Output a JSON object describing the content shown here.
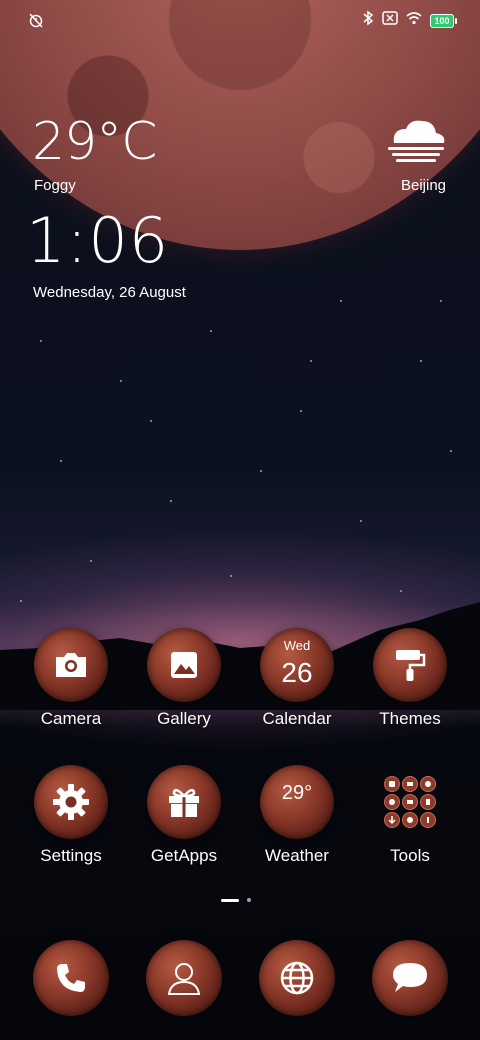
{
  "status": {
    "battery": "100"
  },
  "weather": {
    "temperature": "29°C",
    "condition": "Foggy",
    "city": "Beijing"
  },
  "clock": {
    "time": "1:06",
    "date": "Wednesday, 26 August"
  },
  "apps_row1": [
    {
      "label": "Camera",
      "icon": "camera-icon"
    },
    {
      "label": "Gallery",
      "icon": "image-icon"
    },
    {
      "label": "Calendar",
      "icon": "calendar-icon",
      "day": "Wed",
      "num": "26"
    },
    {
      "label": "Themes",
      "icon": "paint-roller-icon"
    }
  ],
  "apps_row2": [
    {
      "label": "Settings",
      "icon": "gear-icon"
    },
    {
      "label": "GetApps",
      "icon": "gift-icon"
    },
    {
      "label": "Weather",
      "icon": "weather-icon",
      "temp": "29°"
    },
    {
      "label": "Tools",
      "icon": "folder-icon"
    }
  ],
  "dock": [
    {
      "icon": "phone-icon"
    },
    {
      "icon": "contacts-icon"
    },
    {
      "icon": "browser-globe-icon"
    },
    {
      "icon": "messages-icon"
    }
  ]
}
